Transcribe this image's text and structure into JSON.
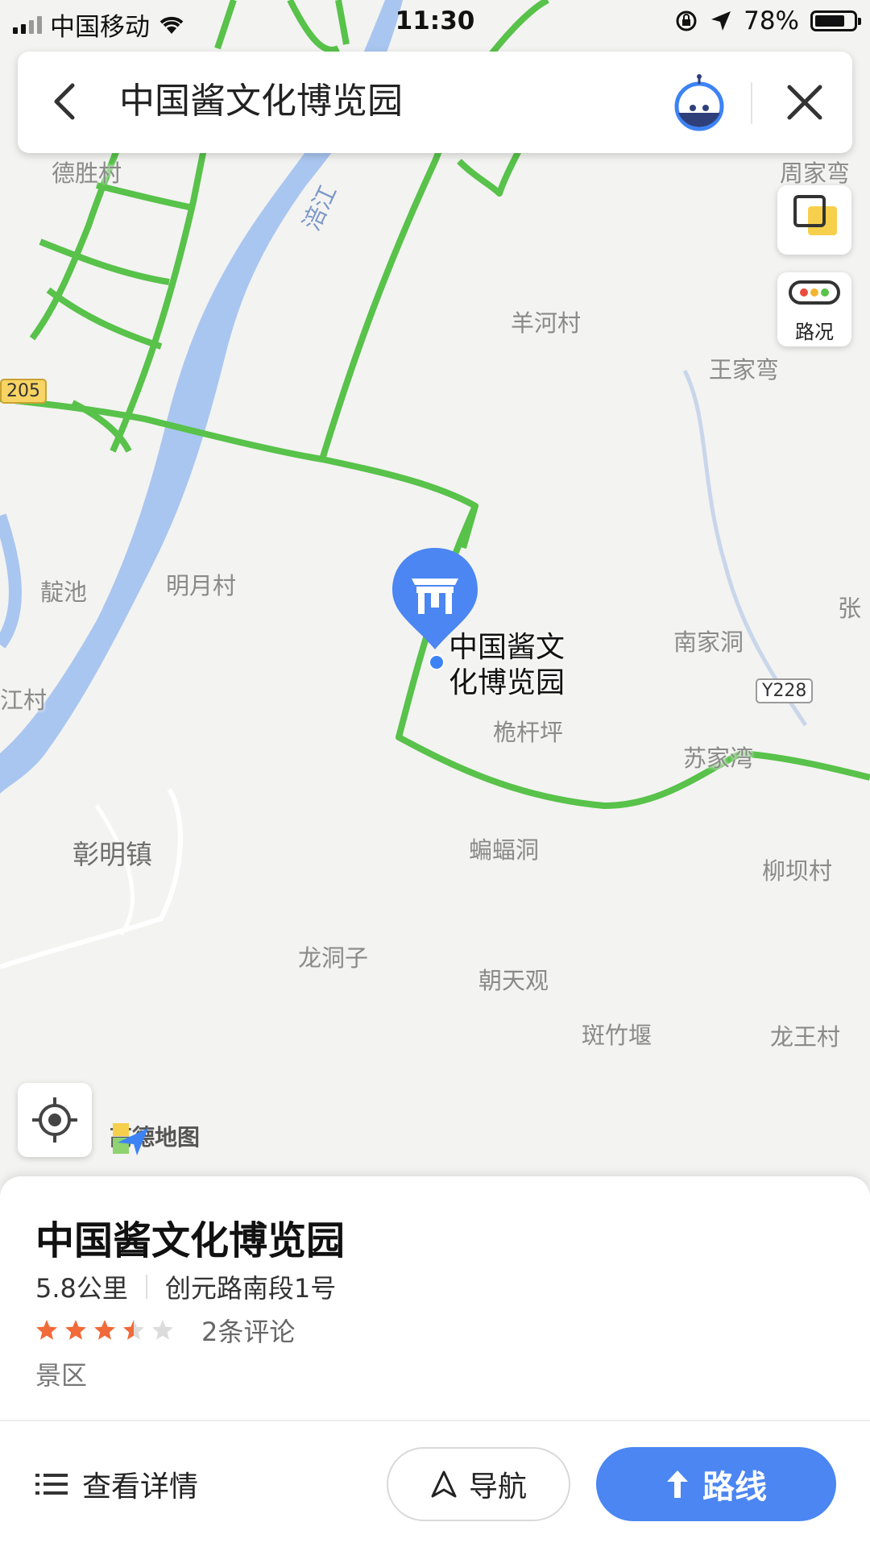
{
  "status_bar": {
    "carrier": "中国移动",
    "time": "11:30",
    "battery": "78%",
    "battery_level": 0.78
  },
  "search": {
    "query": "中国酱文化博览园",
    "icons": [
      "back-arrow-icon",
      "assistant-robot-icon",
      "close-icon"
    ]
  },
  "map": {
    "labels": {
      "deshengcun": "德胜村",
      "zhoujiawan": "周家弯",
      "yanghecun": "羊河村",
      "wangjiawan": "王家弯",
      "dingchi": "靛池",
      "mingyuecun": "明月村",
      "nanjiadong": "南家洞",
      "jiangcun": "江村",
      "zhang": "张",
      "weiganping": "桅杆坪",
      "sujiawan": "苏家湾",
      "pengmingzhen": "彰明镇",
      "bianfudong": "蝙蝠洞",
      "liubacun": "柳坝村",
      "longdongzi": "龙洞子",
      "chaotianguan": "朝天观",
      "banzhuyan": "斑竹堰",
      "longwangcun": "龙王村",
      "river": "涪江"
    },
    "road_shields": {
      "r205": "205",
      "y228": "Y228"
    },
    "poi_name": "中国酱文化博览园",
    "brand": "高德地图",
    "traffic_label": "路况",
    "colors": {
      "road": "#58c24a",
      "river": "#a9c6f0",
      "accent": "#4b86f2"
    }
  },
  "place_card": {
    "title": "中国酱文化博览园",
    "distance": "5.8公里",
    "address": "创元路南段1号",
    "rating": 3.5,
    "rating_max": 5,
    "reviews": "2条评论",
    "category": "景区",
    "details_label": "查看详情",
    "nav_label": "导航",
    "route_label": "路线"
  }
}
